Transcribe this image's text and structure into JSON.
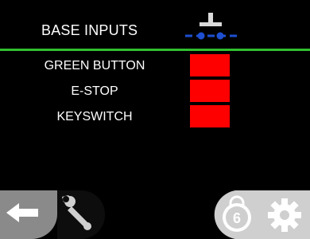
{
  "header": {
    "title": "BASE INPUTS",
    "icon": "pushbutton-icon"
  },
  "colors": {
    "background": "#000000",
    "divider": "#2fbf2f",
    "indicator_off": "#ff0000",
    "icon_contact_blue": "#1e4fd0",
    "icon_gray": "#d9d9d9",
    "nav_button_dark": "#8a8a8a",
    "nav_button_light": "#cfcfcf"
  },
  "inputs": [
    {
      "label": "GREEN BUTTON",
      "state_color": "#ff0000"
    },
    {
      "label": "E-STOP",
      "state_color": "#ff0000"
    },
    {
      "label": "KEYSWITCH",
      "state_color": "#ff0000"
    }
  ],
  "nav": {
    "buttons": [
      "back-arrow-icon",
      "wrench-icon",
      "lock-6-icon",
      "gear-icon"
    ],
    "lock_number": "6"
  }
}
